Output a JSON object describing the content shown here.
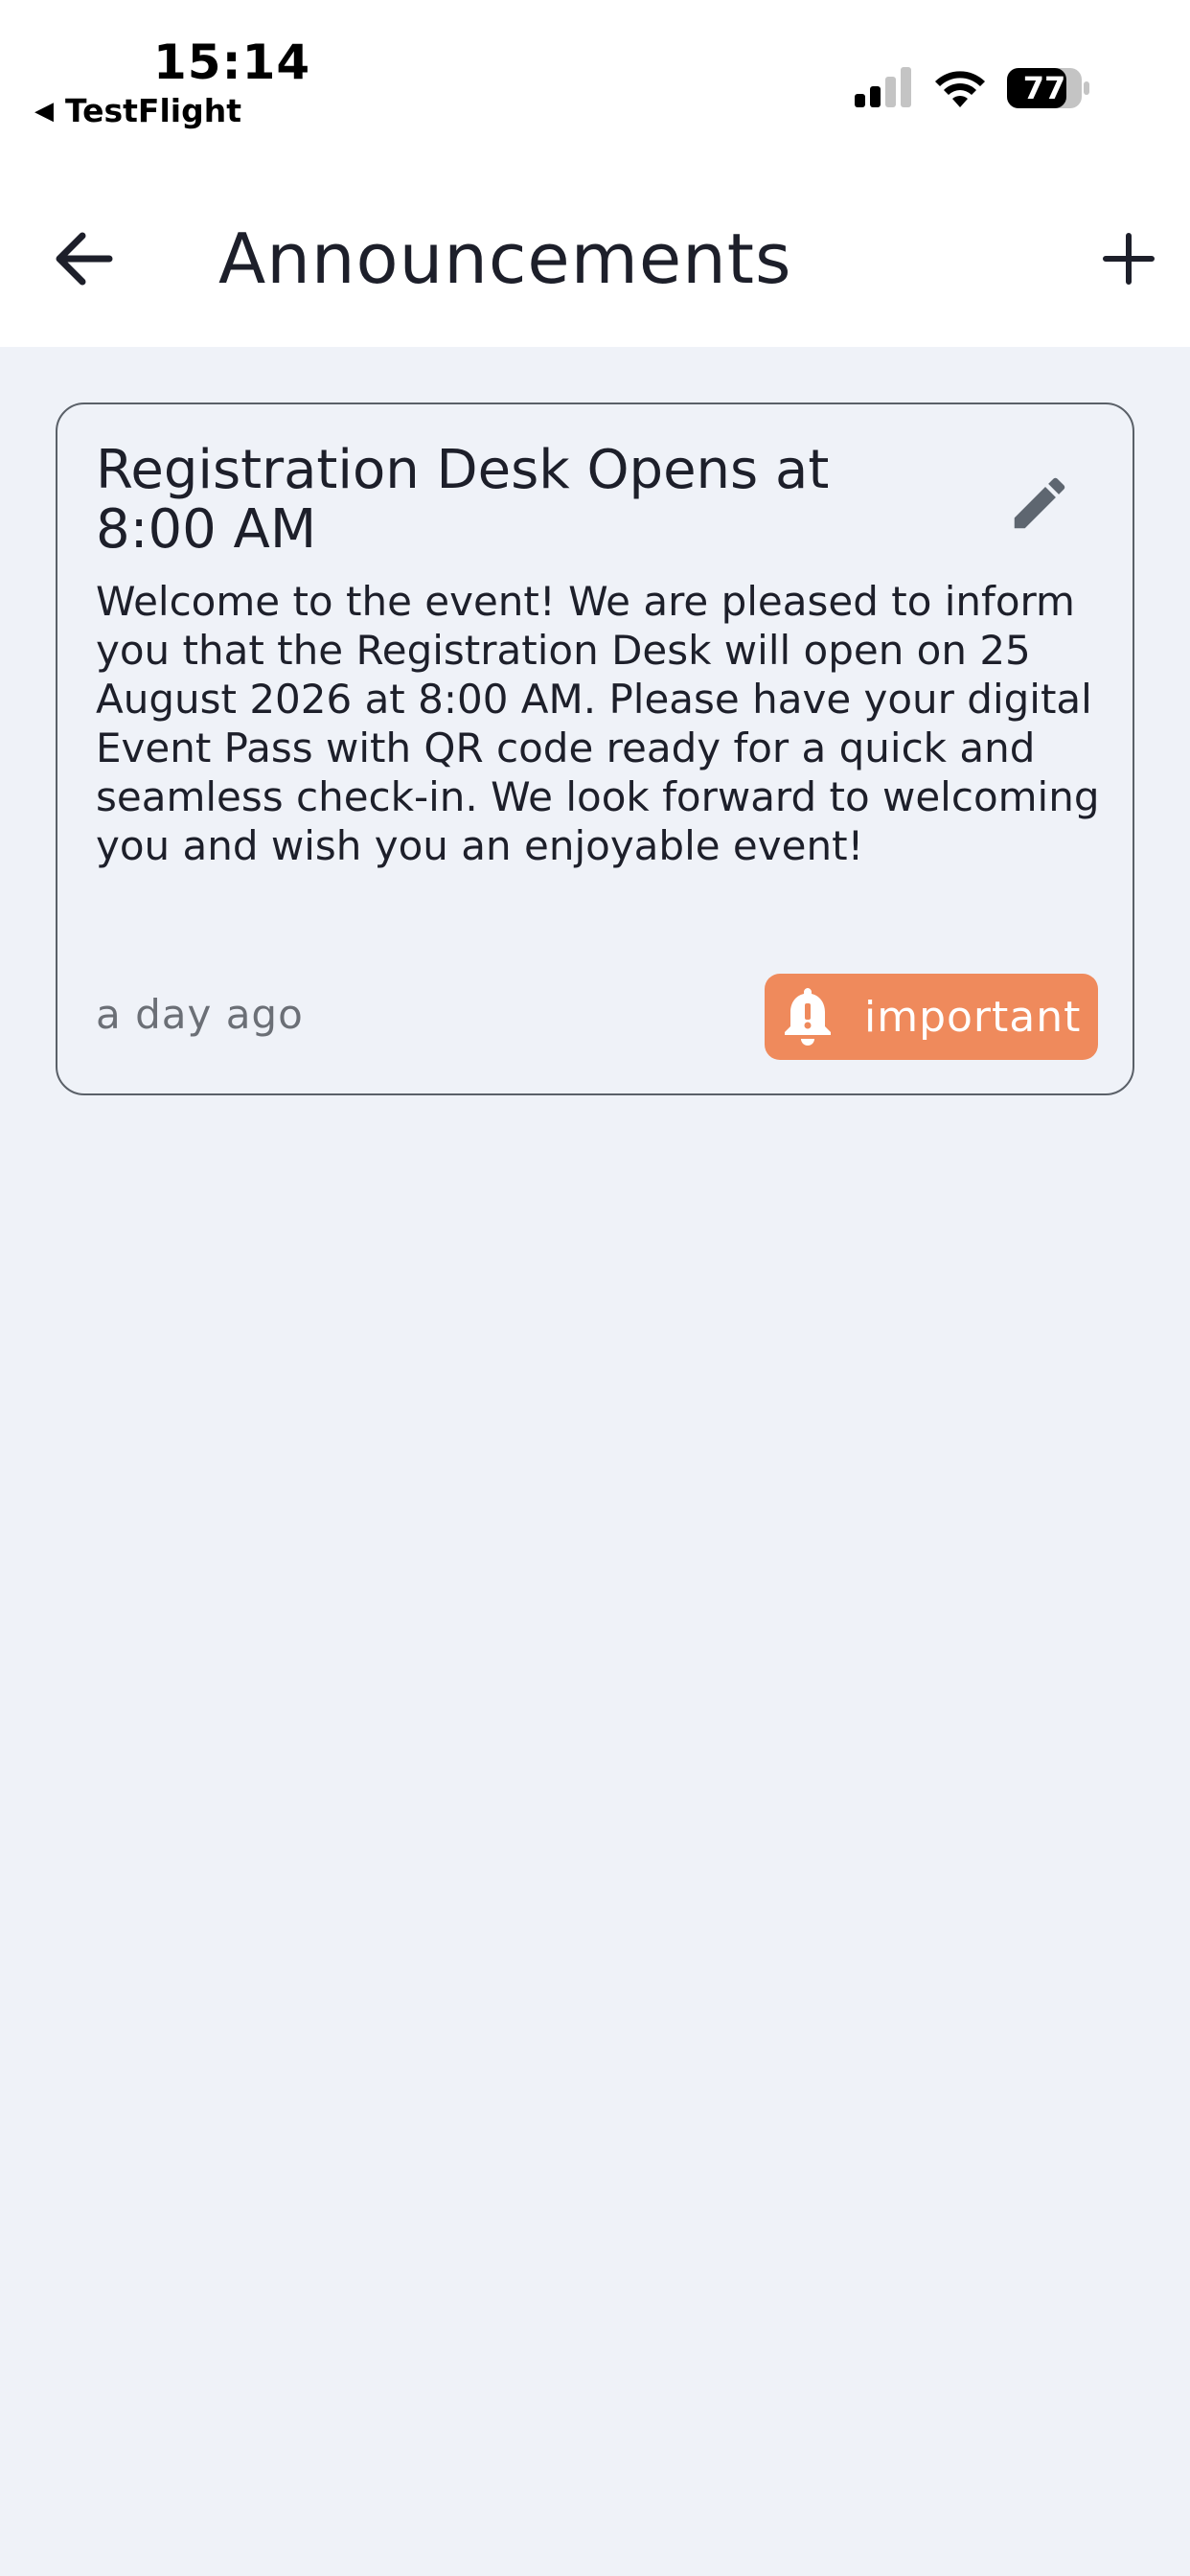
{
  "status_bar": {
    "time": "15:14",
    "back_app": "TestFlight",
    "battery_level": "77"
  },
  "header": {
    "title": "Announcements"
  },
  "announcements": [
    {
      "title": "Registration Desk Opens at 8:00 AM",
      "body": "Welcome to the event! We are pleased to inform you that the Registration Desk will open on 25 August 2026 at 8:00 AM. Please have your digital Event Pass with QR code ready for a quick and seamless check-in. We look forward to welcoming you and wish you an enjoyable event!",
      "time_ago": "a day ago",
      "tag": "important"
    }
  ],
  "colors": {
    "background": "#eff2f8",
    "badge": "#ef8a5c",
    "text": "#1d1f2a",
    "muted": "#6b6f76"
  },
  "icons": {
    "back": "arrow-left-icon",
    "add": "plus-icon",
    "edit": "pencil-icon",
    "tag": "bell-alert-icon"
  }
}
